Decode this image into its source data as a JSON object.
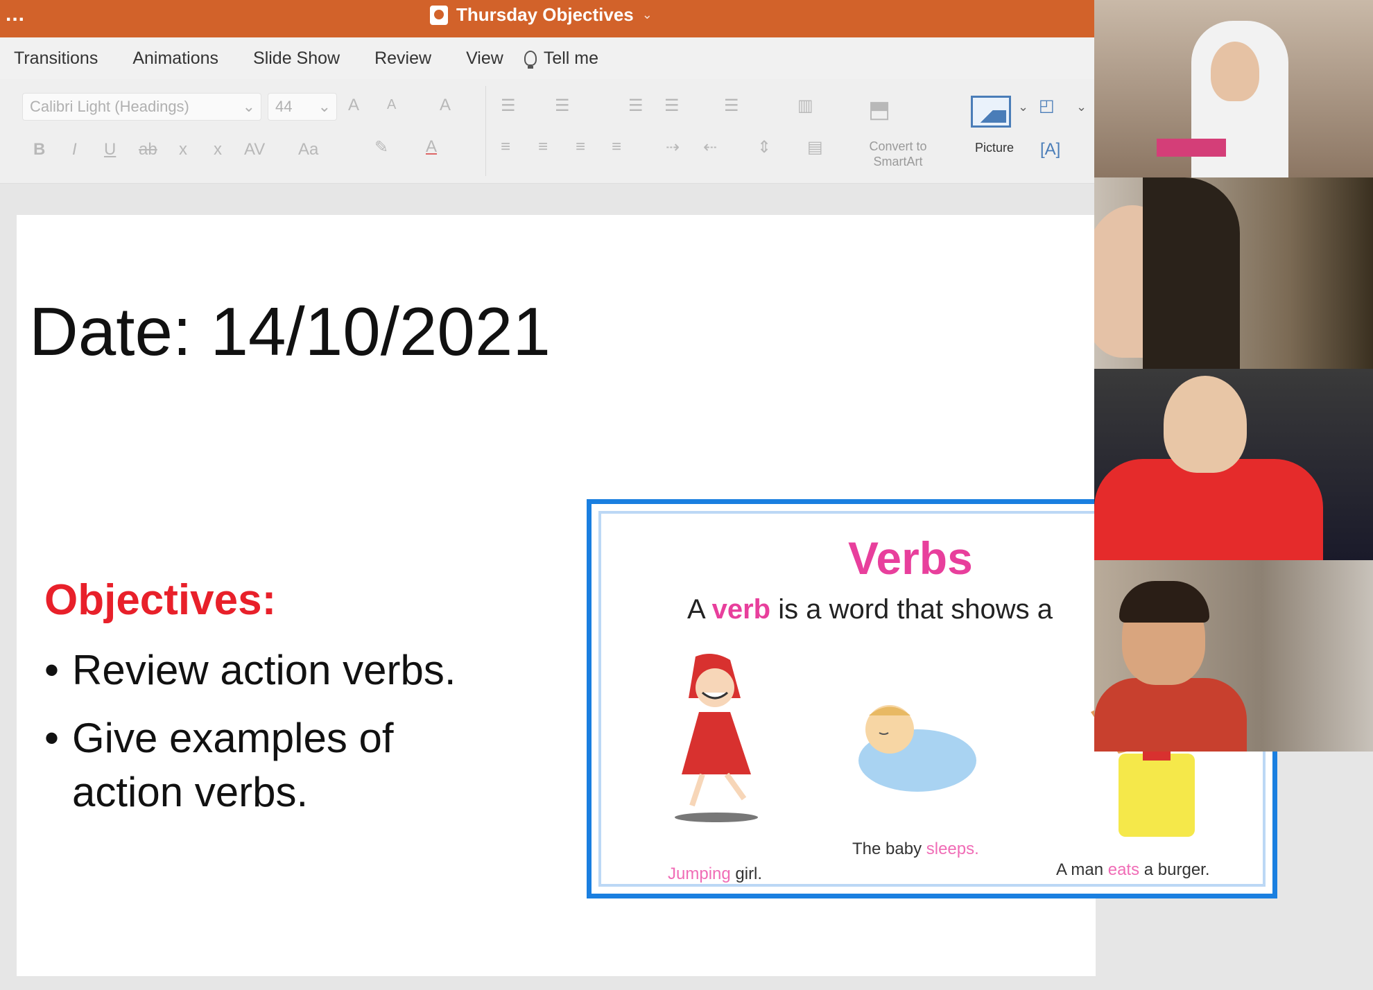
{
  "window": {
    "document_title": "Thursday Objectives",
    "title_chevron": "⌄",
    "more_icon": "..."
  },
  "menu": {
    "tabs": [
      "Transitions",
      "Animations",
      "Slide Show",
      "Review",
      "View"
    ],
    "tell_me": "Tell me"
  },
  "ribbon": {
    "font_name": "Calibri Light (Headings)",
    "font_size": "44",
    "convert_smartart_line1": "Convert to",
    "convert_smartart_line2": "SmartArt",
    "picture_label": "Picture"
  },
  "slide": {
    "date_line": "Date: 14/10/2021",
    "objectives_heading": "Objectives:",
    "objectives": [
      "Review action verbs.",
      "Give examples of action verbs."
    ]
  },
  "verbs_image": {
    "title": "Verbs",
    "def_prefix": "A ",
    "def_highlight": "verb",
    "def_suffix": " is a word that shows a",
    "caption1_highlight": "Jumping",
    "caption1_rest": " girl.",
    "caption2_prefix": "The baby ",
    "caption2_highlight": "sleeps.",
    "caption3_prefix": "A man ",
    "caption3_highlight": "eats",
    "caption3_suffix": " a burger."
  },
  "colors": {
    "titlebar": "#d2622a",
    "objectives_red": "#e8202a",
    "verb_pink": "#e83f9c",
    "frame_blue": "#1a7fe0"
  }
}
